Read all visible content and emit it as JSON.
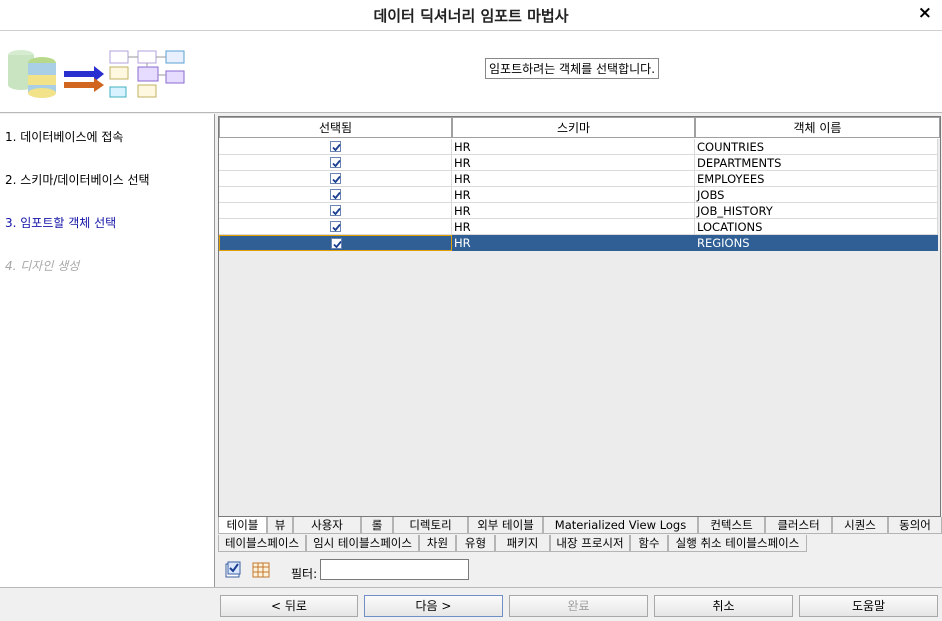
{
  "window": {
    "title": "데이터 딕셔너리 임포트 마법사",
    "close_glyph": "×"
  },
  "header": {
    "message": "임포트하려는 객체를 선택합니다."
  },
  "steps": [
    {
      "label": "1. 데이터베이스에 접속",
      "state": "done"
    },
    {
      "label": "2. 스키마/데이터베이스 선택",
      "state": "done"
    },
    {
      "label": "3. 임포트할 객체 선택",
      "state": "current"
    },
    {
      "label": "4. 디자인 생성",
      "state": "disabled"
    }
  ],
  "table": {
    "columns": [
      "선택됨",
      "스키마",
      "객체 이름"
    ],
    "rows": [
      {
        "selected": true,
        "schema": "HR",
        "name": "COUNTRIES"
      },
      {
        "selected": true,
        "schema": "HR",
        "name": "DEPARTMENTS"
      },
      {
        "selected": true,
        "schema": "HR",
        "name": "EMPLOYEES"
      },
      {
        "selected": true,
        "schema": "HR",
        "name": "JOBS"
      },
      {
        "selected": true,
        "schema": "HR",
        "name": "JOB_HISTORY"
      },
      {
        "selected": true,
        "schema": "HR",
        "name": "LOCATIONS"
      },
      {
        "selected": true,
        "schema": "HR",
        "name": "REGIONS"
      }
    ],
    "highlighted_row_color": "#2f5f95"
  },
  "tabs_row1": [
    "테이블",
    "뷰",
    "사용자",
    "롤",
    "디렉토리",
    "외부 테이블",
    "Materialized View Logs",
    "컨텍스트",
    "클러스터",
    "시퀀스",
    "동의어"
  ],
  "tabs_row2": [
    "테이블스페이스",
    "임시 테이블스페이스",
    "차원",
    "유형",
    "패키지",
    "내장 프로시저",
    "함수",
    "실행 취소 테이블스페이스"
  ],
  "active_tab": "테이블",
  "toolbar": {
    "select_all_icon": "check-all-icon",
    "table_icon": "table-grid-icon"
  },
  "filter": {
    "label": "필터:",
    "value": ""
  },
  "buttons": {
    "back": "< 뒤로",
    "next": "다음 >",
    "finish": "완료",
    "cancel": "취소",
    "help": "도움말"
  }
}
